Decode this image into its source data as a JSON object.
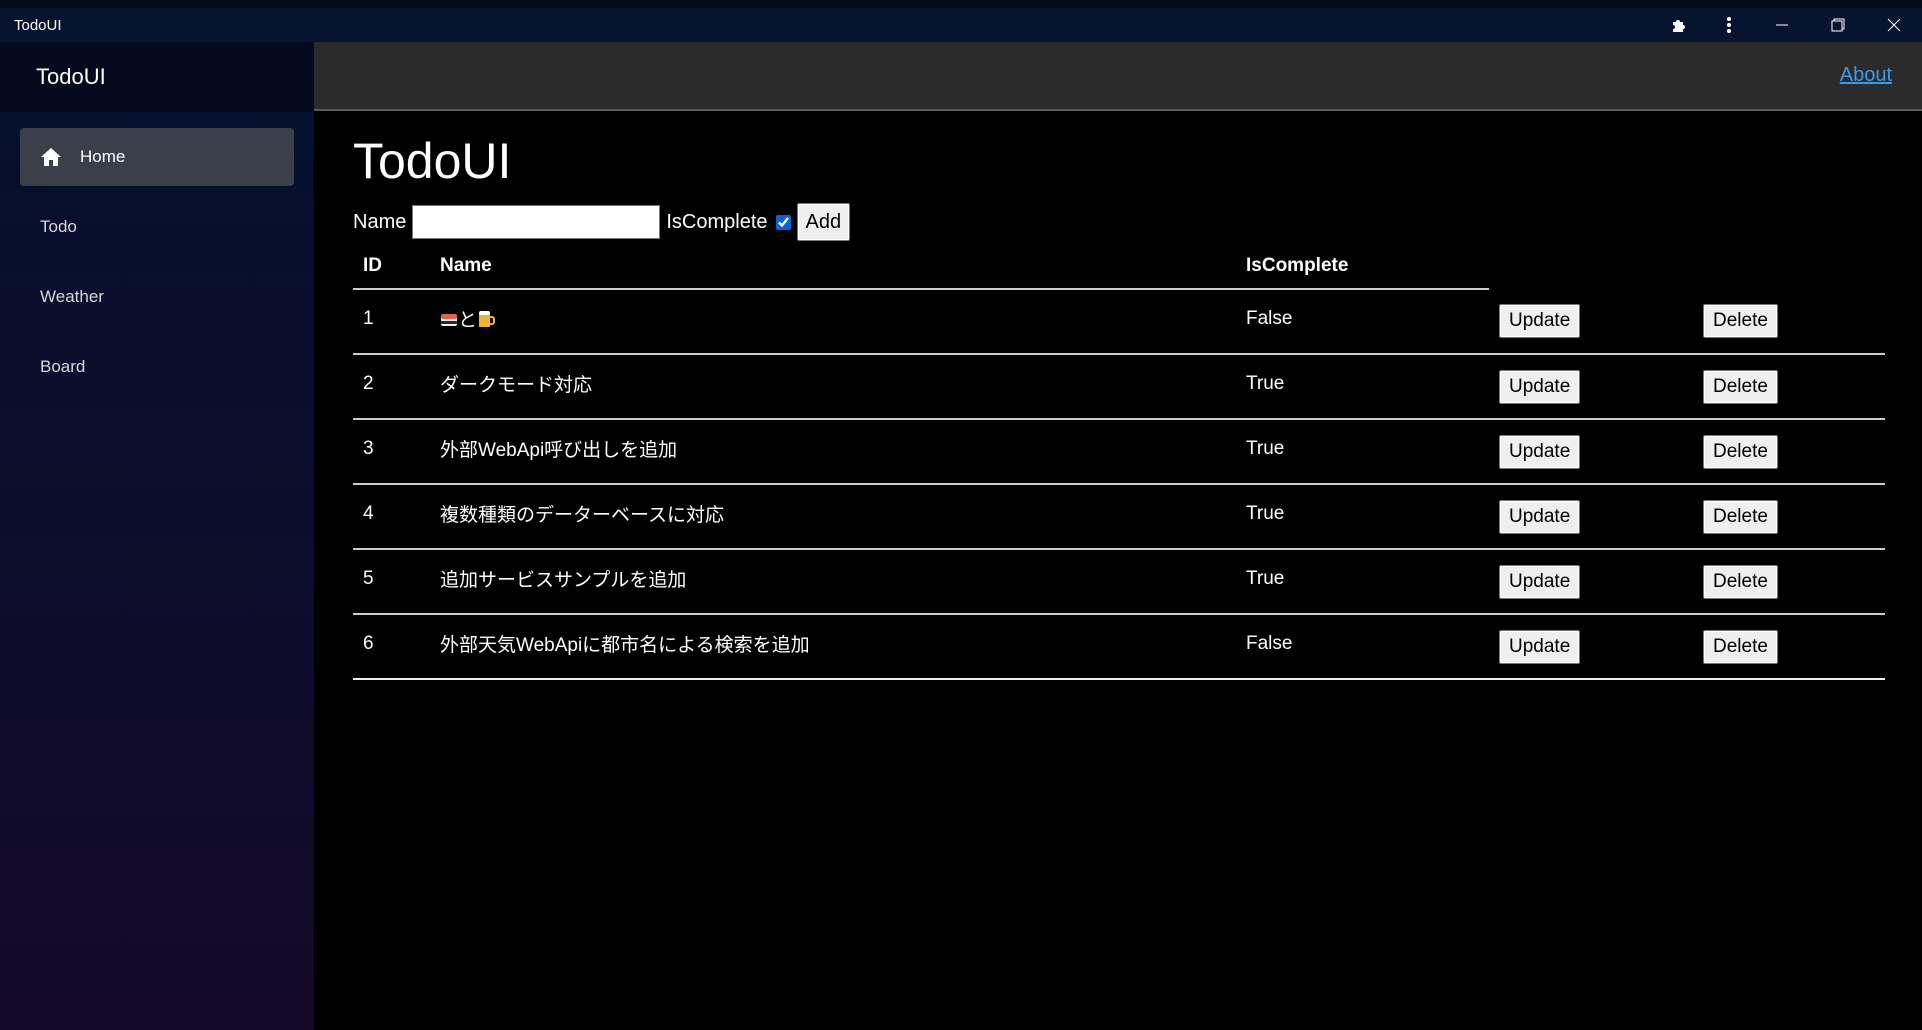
{
  "window": {
    "title": "TodoUI"
  },
  "sidebar": {
    "brand": "TodoUI",
    "items": [
      {
        "label": "Home",
        "icon": "home-icon",
        "active": true
      },
      {
        "label": "Todo"
      },
      {
        "label": "Weather"
      },
      {
        "label": "Board"
      }
    ]
  },
  "topbar": {
    "about": "About"
  },
  "main": {
    "title": "TodoUI",
    "form": {
      "name_label": "Name",
      "name_value": "",
      "complete_label": "IsComplete",
      "complete_checked": true,
      "add_label": "Add"
    },
    "table": {
      "headers": [
        "ID",
        "Name",
        "IsComplete"
      ],
      "update_label": "Update",
      "delete_label": "Delete",
      "rows": [
        {
          "id": "1",
          "name": "と",
          "name_emoji": [
            "sushi-icon",
            "beer-icon"
          ],
          "complete": "False"
        },
        {
          "id": "2",
          "name": "ダークモード対応",
          "complete": "True"
        },
        {
          "id": "3",
          "name": "外部WebApi呼び出しを追加",
          "complete": "True"
        },
        {
          "id": "4",
          "name": "複数種類のデーターベースに対応",
          "complete": "True"
        },
        {
          "id": "5",
          "name": "追加サービスサンプルを追加",
          "complete": "True"
        },
        {
          "id": "6",
          "name": "外部天気WebApiに都市名による検索を追加",
          "complete": "False"
        }
      ]
    }
  },
  "colors": {
    "link": "#3b9ae8",
    "sidebar_top": "#051030",
    "sidebar_bottom": "#140a28",
    "active_item": "#3a3f4a"
  }
}
